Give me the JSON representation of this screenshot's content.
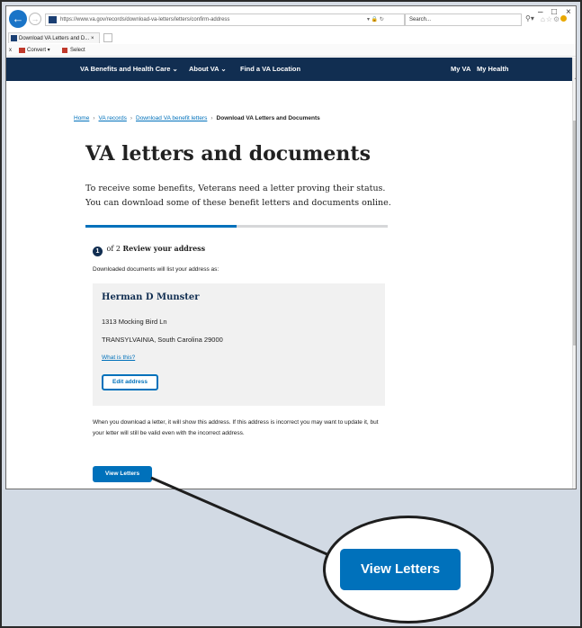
{
  "browser": {
    "url": "https://www.va.gov/records/download-va-letters/letters/confirm-address",
    "search_placeholder": "Search...",
    "tab_title": "Download VA Letters and D...",
    "tab_close": "×",
    "window_controls": [
      "–",
      "□",
      "×"
    ],
    "command_bar": {
      "close": "x",
      "convert": "Convert ▾",
      "select": "Select"
    },
    "icons": {
      "back": "back-arrow-icon",
      "forward": "forward-arrow-icon",
      "search": "search-icon",
      "home": "home-icon",
      "favorites": "star-icon",
      "settings": "gear-icon"
    }
  },
  "site_nav": {
    "items": [
      {
        "label": "VA Benefits and Health Care ⌄"
      },
      {
        "label": "About VA ⌄"
      },
      {
        "label": "Find a VA Location"
      }
    ],
    "right_items": [
      {
        "label": "My VA"
      },
      {
        "label": "My Health"
      }
    ],
    "brand_color": "#112e51"
  },
  "breadcrumb": {
    "items": [
      "Home",
      "VA records",
      "Download VA benefit letters"
    ],
    "current": "Download VA Letters and Documents",
    "separator": "›"
  },
  "page": {
    "title": "VA letters and documents",
    "lead": "To receive some benefits, Veterans need a letter proving their status. You can download some of these benefit letters and documents online.",
    "progress_fraction": 0.5,
    "step": {
      "number": "1",
      "of_text": "of 2",
      "title": "Review your address"
    },
    "subtext": "Downloaded documents will list your address as:",
    "address": {
      "name": "Herman D Munster",
      "line1": "1313 Mocking Bird Ln",
      "line2": "TRANSYLVAINIA, South Carolina 29000",
      "help_link": "What is this?",
      "edit_button": "Edit address"
    },
    "note": "When you download a letter, it will show this address. If this address is incorrect you may want to update it, but your letter will still be valid even with the incorrect address.",
    "view_button": "View Letters",
    "accent_color": "#0071bb"
  },
  "callout": {
    "label": "View Letters"
  }
}
